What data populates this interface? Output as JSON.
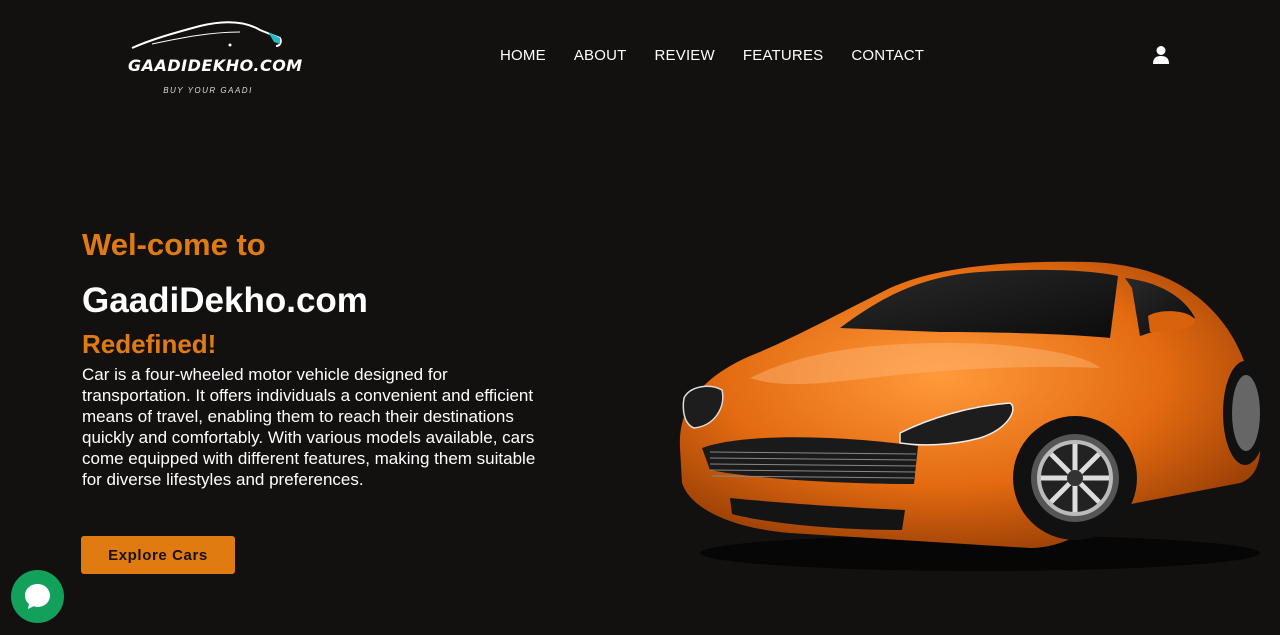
{
  "logo": {
    "title": "GAADIDEKHO.COM",
    "tagline": "BUY YOUR GAADI",
    "icon": "car-silhouette-icon"
  },
  "nav": {
    "items": [
      {
        "label": "HOME"
      },
      {
        "label": "ABOUT"
      },
      {
        "label": "REVIEW"
      },
      {
        "label": "FEATURES"
      },
      {
        "label": "CONTACT"
      }
    ],
    "user_icon": "user-icon"
  },
  "hero": {
    "welcome": "Wel-come to",
    "brand": "GaadiDekho.com",
    "tagline": "Redefined!",
    "description": "Car is a four-wheeled motor vehicle designed for transportation. It offers individuals a convenient and efficient means of travel, enabling them to reach their destinations quickly and comfortably. With various models available, cars come equipped with different features, making them suitable for diverse lifestyles and preferences.",
    "cta": "Explore Cars"
  },
  "chat": {
    "icon": "chat-bubble-icon"
  },
  "colors": {
    "background": "#131010",
    "accent": "#e07b12",
    "chat": "#13a05a",
    "text": "#ffffff"
  }
}
